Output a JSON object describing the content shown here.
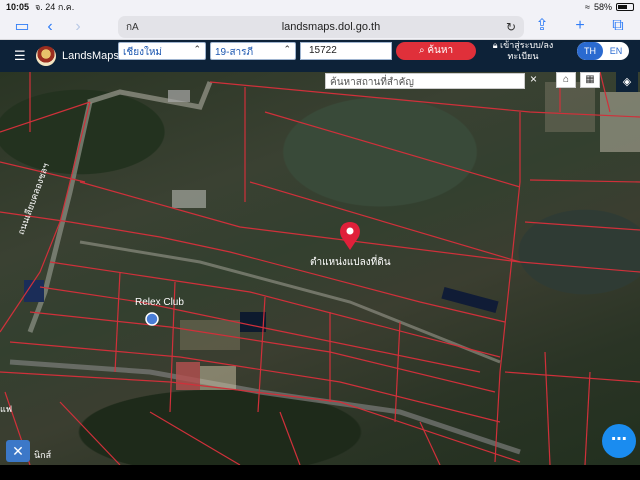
{
  "status_bar": {
    "time": "10:05",
    "date": "จ. 24 ก.ค.",
    "battery": "58%"
  },
  "browser": {
    "url_aa": "กA",
    "domain": "landsmaps.dol.go.th",
    "icons": {
      "sidebar": "sidebar-icon",
      "back": "chevron-left-icon",
      "forward": "chevron-right-icon",
      "reload": "reload-icon",
      "share": "share-icon",
      "new_tab": "plus-icon",
      "tabs": "tabs-icon"
    }
  },
  "app": {
    "brand": "LandsMaps",
    "province": "เชียงใหม่",
    "district": "19-สารภี",
    "parcel_number": "15722",
    "search_label": "ค้นหา",
    "login_line1": "เข้าสู่ระบบ/ลง",
    "login_line2": "ทะเบียน",
    "lang_th": "TH",
    "lang_en": "EN"
  },
  "map": {
    "place_search_placeholder": "ค้นหาสถานที่สำคัญ",
    "marker_label": "ตำแหน่งแปลงที่ดิน",
    "poi_label": "Relex Club",
    "road_label": "ถนนเลียบคลองชลฯ",
    "left_label_1": "แฟ",
    "left_label_2": "นิกส์",
    "colors": {
      "parcel_lines": "#d0303a",
      "marker": "#e0203a",
      "header": "#0d2238",
      "fab": "#1a8cf0"
    }
  }
}
